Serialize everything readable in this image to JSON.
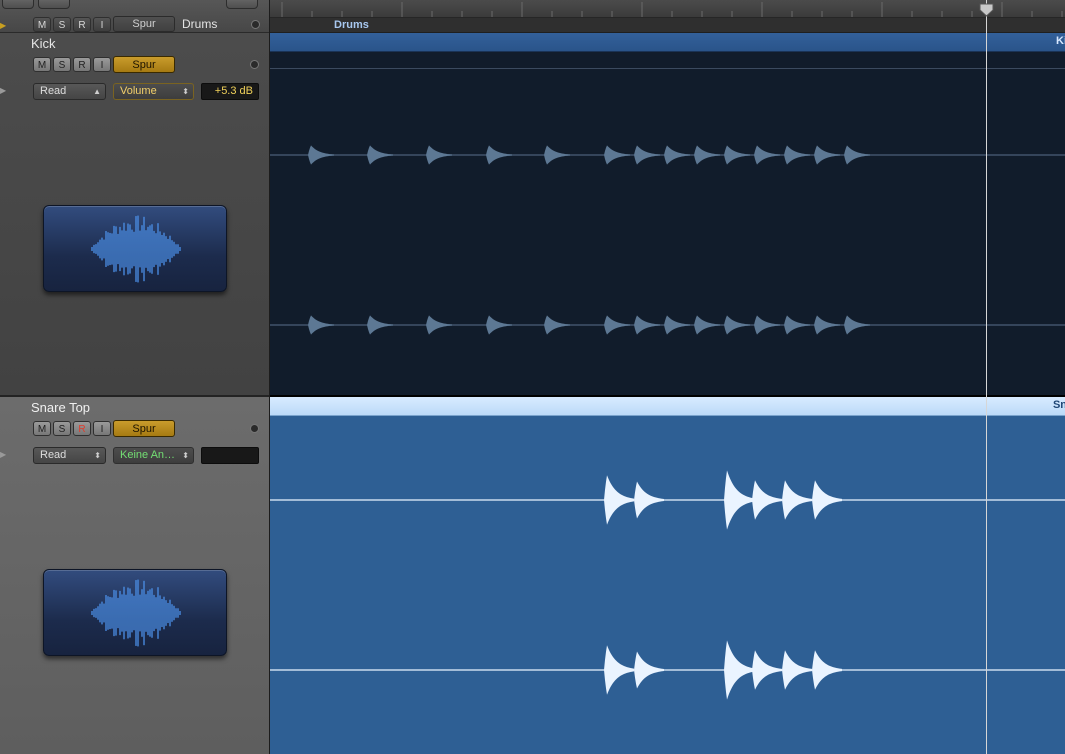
{
  "ruler": {
    "region_label": "Drums"
  },
  "top_strip": {
    "buttons": [
      "M",
      "S",
      "R",
      "I"
    ],
    "spur_label": "Spur",
    "folder_name": "Drums"
  },
  "tracks": [
    {
      "name": "Kick",
      "buttons": [
        "M",
        "S",
        "R",
        "I"
      ],
      "spur_label": "Spur",
      "automation_mode": "Read",
      "automation_param": "Volume",
      "automation_value": "+5.3 dB",
      "region_name_fragment": "Ki"
    },
    {
      "name": "Snare Top",
      "buttons": [
        "M",
        "S",
        "R",
        "I"
      ],
      "spur_label": "Spur",
      "automation_mode": "Read",
      "automation_param": "Keine An…",
      "automation_value": "",
      "region_name_fragment": "Sn"
    }
  ],
  "colors": {
    "spur_gold": "#b8891c",
    "kick_region": "#2a548a",
    "kick_lane": "#111c2b",
    "snare_region": "#2e5f94",
    "snare_header": "#cfe4fb",
    "kick_wave": "#6e8aaa",
    "snare_wave": "#e9f3ff",
    "record": "#e23a2a"
  },
  "icons": {
    "track_icon": "waveform-icon",
    "playhead": "playhead-marker-icon",
    "disclosure": "disclosure-triangle-icon",
    "record_dot": "record-enable-dot-icon"
  }
}
